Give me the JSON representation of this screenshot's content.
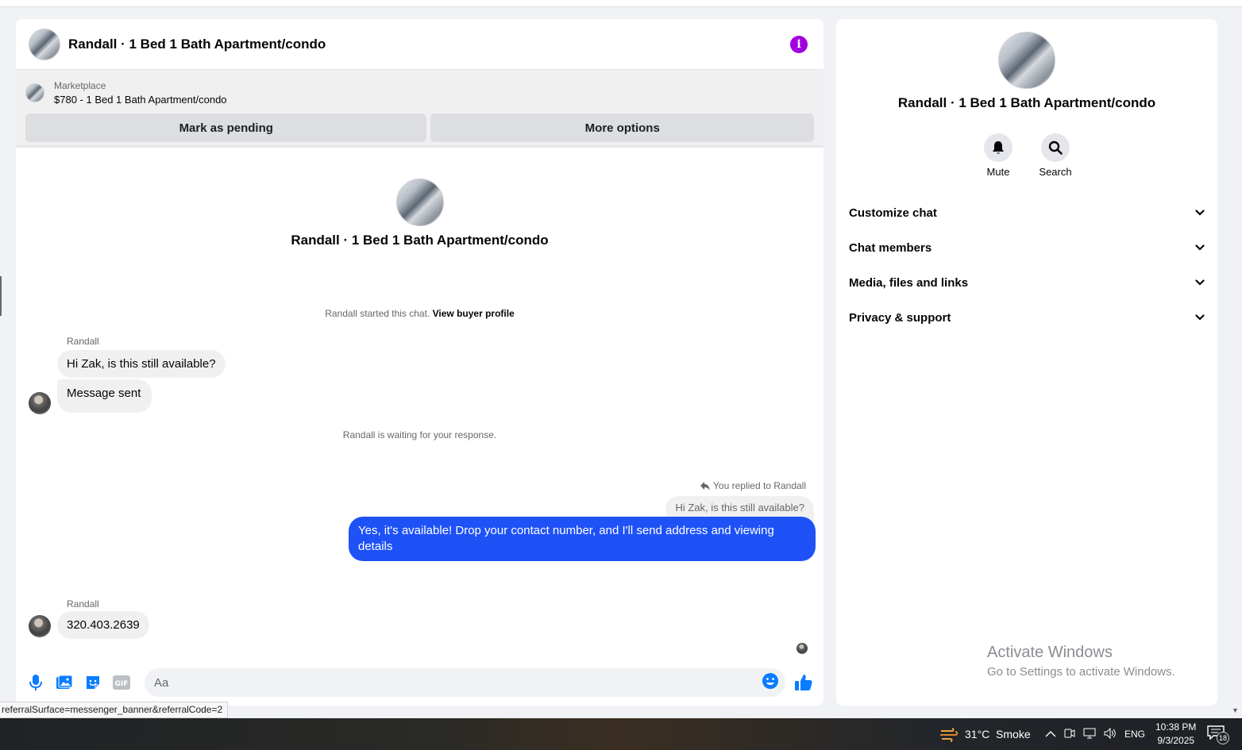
{
  "chat": {
    "title": "Randall · 1 Bed 1 Bath Apartment/condo",
    "marketplace_label": "Marketplace",
    "listing": "$780 - 1 Bed 1 Bath Apartment/condo",
    "mark_pending_label": "Mark as pending",
    "more_options_label": "More options"
  },
  "thread": {
    "intro_name": "Randall · 1 Bed 1 Bath Apartment/condo",
    "started_text": "Randall started this chat.",
    "view_profile_label": "View buyer profile",
    "sender1": "Randall",
    "msg1": "Hi Zak, is this still available?",
    "msg2": "Message sent",
    "waiting_text": "Randall is waiting for your response.",
    "replied_note": "You replied to Randall",
    "quoted": "Hi Zak, is this still available?",
    "reply": "Yes, it's available! Drop your contact number, and I'll send address and viewing details",
    "sender2": "Randall",
    "msg3": "320.403.2639"
  },
  "composer": {
    "placeholder": "Aa",
    "icons": [
      "microphone-icon",
      "photo-icon",
      "sticker-icon",
      "gif-icon",
      "emoji-icon",
      "thumbs-up-icon"
    ],
    "gif_text": "GIF"
  },
  "status_url": "referralSurface=messenger_banner&referralCode=2",
  "side": {
    "name": "Randall · 1 Bed 1 Bath Apartment/condo",
    "mute_label": "Mute",
    "search_label": "Search",
    "sections": [
      "Customize chat",
      "Chat members",
      "Media, files and links",
      "Privacy & support"
    ]
  },
  "watermark": {
    "line1": "Activate Windows",
    "line2": "Go to Settings to activate Windows."
  },
  "taskbar": {
    "weather": "31°C  Smoke",
    "language": "ENG",
    "time": "10:38 PM",
    "date": "9/3/2025",
    "notifications": "18"
  },
  "colors": {
    "accent": "#1e52f7",
    "info": "#a200e0",
    "icon_blue": "#0a7cff"
  }
}
